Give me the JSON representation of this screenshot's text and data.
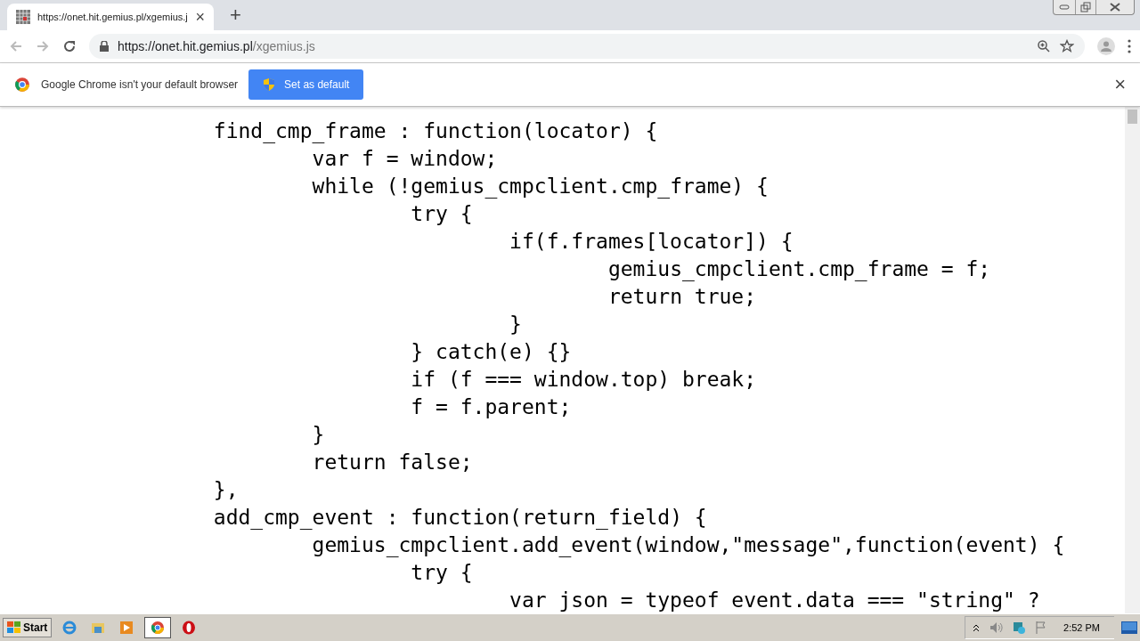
{
  "tab": {
    "title": "https://onet.hit.gemius.pl/xgemius.j",
    "close": "×"
  },
  "new_tab": "+",
  "address": {
    "host": "https://onet.hit.gemius.pl",
    "path": "/xgemius.js"
  },
  "infobar": {
    "message": "Google Chrome isn't your default browser",
    "button": "Set as default",
    "close": "×"
  },
  "code_lines": [
    "\tfind_cmp_frame : function(locator) {",
    "\t\tvar f = window;",
    "\t\twhile (!gemius_cmpclient.cmp_frame) {",
    "\t\t\ttry {",
    "\t\t\t\tif(f.frames[locator]) {",
    "\t\t\t\t\tgemius_cmpclient.cmp_frame = f;",
    "\t\t\t\t\treturn true;",
    "\t\t\t\t}",
    "\t\t\t} catch(e) {}",
    "\t\t\tif (f === window.top) break;",
    "\t\t\tf = f.parent;",
    "\t\t}",
    "\t\treturn false;",
    "\t},",
    "\tadd_cmp_event : function(return_field) {",
    "\t\tgemius_cmpclient.add_event(window,\"message\",function(event) {",
    "\t\t\ttry {",
    "\t\t\t\tvar json = typeof event.data === \"string\" ?"
  ],
  "taskbar": {
    "start": "Start",
    "apps": [
      {
        "kind": "ie",
        "selected": false
      },
      {
        "kind": "folder",
        "selected": false
      },
      {
        "kind": "media",
        "selected": false
      },
      {
        "kind": "chrome",
        "selected": true
      },
      {
        "kind": "opera",
        "selected": false
      }
    ],
    "clock": "2:52 PM"
  }
}
